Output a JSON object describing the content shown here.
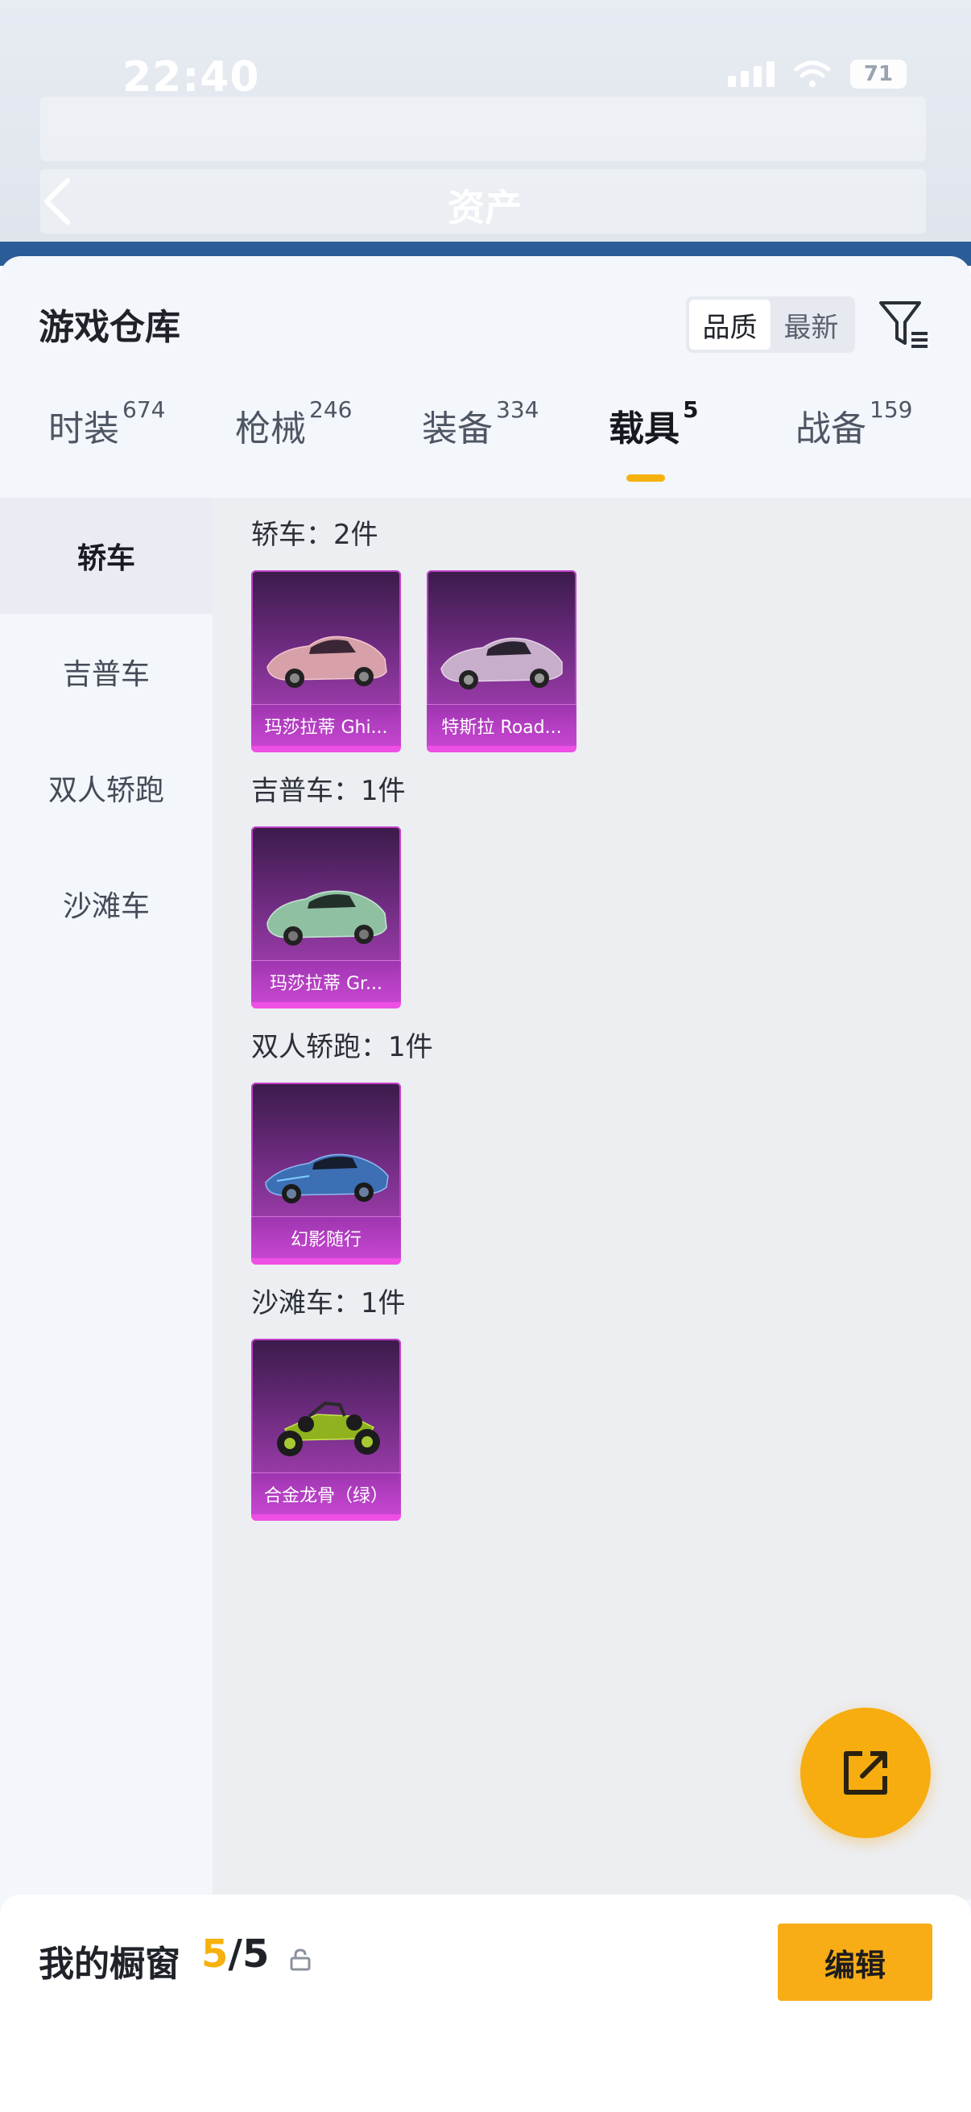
{
  "status_bar": {
    "time": "22:40",
    "battery": "71"
  },
  "header": {
    "title": "资产"
  },
  "panel": {
    "title": "游戏仓库",
    "sort_options": [
      "品质",
      "最新"
    ],
    "active_sort": "品质"
  },
  "tabs": [
    {
      "label": "时装",
      "count": "674"
    },
    {
      "label": "枪械",
      "count": "246"
    },
    {
      "label": "装备",
      "count": "334"
    },
    {
      "label": "载具",
      "count": "5"
    },
    {
      "label": "战备",
      "count": "159"
    }
  ],
  "active_tab": "载具",
  "sidebar": [
    {
      "label": "轿车"
    },
    {
      "label": "吉普车"
    },
    {
      "label": "双人轿跑"
    },
    {
      "label": "沙滩车"
    }
  ],
  "sections": [
    {
      "title": "轿车：2件",
      "items": [
        {
          "name": "玛莎拉蒂 Ghi..."
        },
        {
          "name": "特斯拉 Road..."
        }
      ]
    },
    {
      "title": "吉普车：1件",
      "items": [
        {
          "name": "玛莎拉蒂 Gr..."
        }
      ]
    },
    {
      "title": "双人轿跑：1件",
      "items": [
        {
          "name": "幻影随行"
        }
      ]
    },
    {
      "title": "沙滩车：1件",
      "items": [
        {
          "name": "合金龙骨（绿）"
        }
      ]
    }
  ],
  "showcase": {
    "label": "我的橱窗",
    "current": "5",
    "total": "/5"
  },
  "edit_label": "编辑",
  "colors": {
    "accent": "#f6b10c",
    "card_bg": "#6a2a7c",
    "card_border": "#ee4fe4"
  }
}
